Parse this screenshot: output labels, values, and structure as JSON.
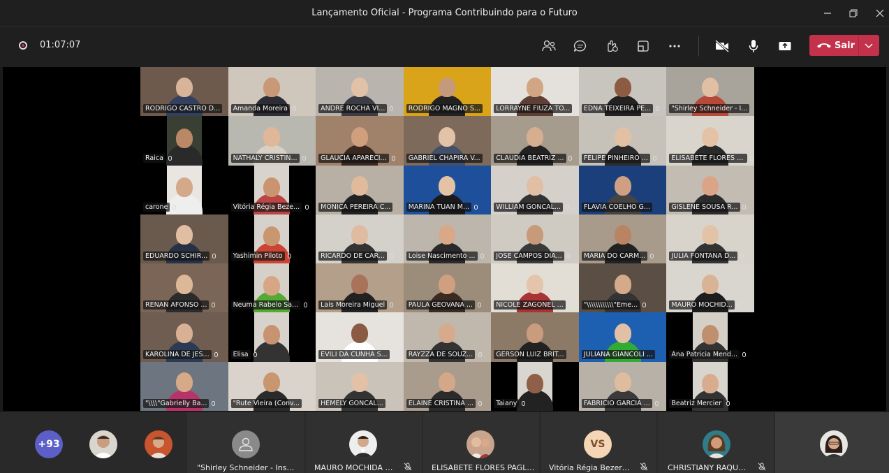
{
  "window": {
    "title": "Lançamento Oficial - Programa Contribuindo para o Futuro"
  },
  "toolbar": {
    "timer": "01:07:07",
    "leave_label": "Sair"
  },
  "colors": {
    "accent": "#5b5fc7",
    "leave": "#c4314b"
  },
  "tiles": [
    {
      "name": "RODRIGO CASTRO D...",
      "mic": false,
      "bg": "#6d5a4c",
      "skin": "#d8b49a",
      "shirt": "#33415e"
    },
    {
      "name": "Amanda Moreira",
      "mic": true,
      "bg": "#cfc6bc",
      "skin": "#c89877",
      "shirt": "#2d2d35"
    },
    {
      "name": "ANDRE ROCHA VI...",
      "mic": true,
      "bg": "#b9b4ad",
      "skin": "#e2c2a6",
      "shirt": "#3c3c44"
    },
    {
      "name": "RODRIGO MAGNO S...",
      "mic": false,
      "bg": "#d9a31a",
      "skin": "#c59a7c",
      "shirt": "#222"
    },
    {
      "name": "LORRAYNE FIUZA TO...",
      "mic": false,
      "bg": "#e4e1dc",
      "skin": "#d2a584",
      "shirt": "#5d3f35"
    },
    {
      "name": "EDNA TEIXEIRA PE...",
      "mic": true,
      "bg": "#c8c5bf",
      "skin": "#8d5b42",
      "shirt": "#222"
    },
    {
      "name": "\"Shirley Schneider - I...",
      "mic": false,
      "bg": "#a8a39b",
      "skin": "#e1bfa2",
      "shirt": "#b54a3b"
    },
    {
      "name": "Raica",
      "mic": true,
      "bg": "#3a3f33",
      "skin": "#b98866",
      "shirt": "#2a2a2a",
      "narrow": true
    },
    {
      "name": "NATHALY CRISTIN...",
      "mic": true,
      "bg": "#b9b8b0",
      "skin": "#e0b899",
      "shirt": "#d8d0c4"
    },
    {
      "name": "GLAUCIA APARECI...",
      "mic": true,
      "bg": "#a0826a",
      "skin": "#cf9f7e",
      "shirt": "#3a2820"
    },
    {
      "name": "GABRIEL CHAPIRA V...",
      "mic": false,
      "bg": "#7d6a5a",
      "skin": "#e2c3a8",
      "shirt": "#44506a"
    },
    {
      "name": "CLAUDIA BEATRIZ ...",
      "mic": true,
      "bg": "#a59c8e",
      "skin": "#d6ae90",
      "shirt": "#222"
    },
    {
      "name": "FELIPE PINHEIRO ...",
      "mic": true,
      "bg": "#c6c2ba",
      "skin": "#e2c0a4",
      "shirt": "#2b2b2b"
    },
    {
      "name": "ELISABETE FLORES P...",
      "mic": true,
      "bg": "#d9d5cc",
      "skin": "#e4c2a5",
      "shirt": "#2a2a2a"
    },
    {
      "name": "carone",
      "mic": true,
      "bg": "#e9e6e1",
      "skin": "#d3a98a",
      "shirt": "#eee",
      "narrow": true
    },
    {
      "name": "Vitória Régia Beze...",
      "mic": true,
      "bg": "#d8d4cd",
      "skin": "#c9946f",
      "shirt": "#b44",
      "narrow": true
    },
    {
      "name": "MONICA PEREIRA C...",
      "mic": false,
      "bg": "#b8b0a4",
      "skin": "#e0bb9b",
      "shirt": "#222"
    },
    {
      "name": "MARINA TUAN M...",
      "mic": true,
      "bg": "#1e4f9a",
      "skin": "#e4c2a6",
      "shirt": "#1a1a1a"
    },
    {
      "name": "WILLIAM GONCAL...",
      "mic": true,
      "bg": "#d5d1ca",
      "skin": "#e1bfa4",
      "shirt": "#333"
    },
    {
      "name": "FLAVIA COELHO G...",
      "mic": false,
      "bg": "#1b3f7a",
      "skin": "#cf9f82",
      "shirt": "#444"
    },
    {
      "name": "GISLENE SOUSA R...",
      "mic": true,
      "bg": "#c2bcb2",
      "skin": "#d9a586",
      "shirt": "#2c2c2c"
    },
    {
      "name": "EDUARDO SCHIR...",
      "mic": true,
      "bg": "#6a5a4d",
      "skin": "#e0bea2",
      "shirt": "#263145"
    },
    {
      "name": "Yashimin Piloto",
      "mic": true,
      "bg": "#d6d2cb",
      "skin": "#c8966f",
      "shirt": "#c43",
      "narrow": true
    },
    {
      "name": "RICARDO DE CAR...",
      "mic": true,
      "bg": "#d4d1cb",
      "skin": "#dfbc9f",
      "shirt": "#333"
    },
    {
      "name": "Loise Nascimento ...",
      "mic": true,
      "bg": "#bcb6ac",
      "skin": "#d9a888",
      "shirt": "#2a2a2a"
    },
    {
      "name": "JOSE CAMPOS DIA...",
      "mic": true,
      "bg": "#cfcac2",
      "skin": "#c79a7a",
      "shirt": "#3a3a3a"
    },
    {
      "name": "MARIA DO CARM...",
      "mic": true,
      "bg": "#a89b8b",
      "skin": "#b98463",
      "shirt": "#222"
    },
    {
      "name": "JULIA FONTANA D...",
      "mic": true,
      "bg": "#d8d3cb",
      "skin": "#e3c3a8",
      "shirt": "#333"
    },
    {
      "name": "RENAN AFONSO ...",
      "mic": true,
      "bg": "#7a6556",
      "skin": "#dcb899",
      "shirt": "#2b2b2b"
    },
    {
      "name": "Neuma Rabelo Sa...",
      "mic": true,
      "bg": "#d5d0c8",
      "skin": "#d6a685",
      "shirt": "#5a3",
      "narrow": true
    },
    {
      "name": "Lais Moreira Miguel",
      "mic": true,
      "bg": "#b39f8a",
      "skin": "#a9725a",
      "shirt": "#222"
    },
    {
      "name": "PAULA GEOVANA ...",
      "mic": true,
      "bg": "#9c8c7a",
      "skin": "#cf9f80",
      "shirt": "#3b2a22"
    },
    {
      "name": "NICOLE ZAGONEL ...",
      "mic": true,
      "bg": "#e2ded6",
      "skin": "#e4c4aa",
      "shirt": "#a33"
    },
    {
      "name": "\"\\\\\\\\\\\\\\\\\\\\\\\\\"Eme...",
      "mic": true,
      "bg": "#5b4f45",
      "skin": "#d5aa8a",
      "shirt": "#333"
    },
    {
      "name": "MAURO MOCHID...",
      "mic": true,
      "bg": "#d9d6d0",
      "skin": "#d9b396",
      "shirt": "#1d1d1d"
    },
    {
      "name": "KAROLINA DE JES...",
      "mic": true,
      "bg": "#6e5d50",
      "skin": "#d8b093",
      "shirt": "#2b3a55"
    },
    {
      "name": "Elisa",
      "mic": true,
      "bg": "#d7d2cb",
      "skin": "#c79371",
      "shirt": "#333",
      "narrow": true
    },
    {
      "name": "EVILI DA CUNHA S...",
      "mic": false,
      "bg": "#e6e3de",
      "skin": "#8a5a42",
      "shirt": "#fff"
    },
    {
      "name": "RAYZZA DE SOUZ...",
      "mic": true,
      "bg": "#c0b8ad",
      "skin": "#d6aa8c",
      "shirt": "#333"
    },
    {
      "name": "GERSON LUIZ BRIT...",
      "mic": false,
      "bg": "#8c7a66",
      "skin": "#c99c7d",
      "shirt": "#222"
    },
    {
      "name": "JULIANA GIANCOLI ...",
      "mic": false,
      "bg": "#1d5fb0",
      "skin": "#e2c0a5",
      "shirt": "#3a3"
    },
    {
      "name": "Ana Patricia Mend...",
      "mic": true,
      "bg": "#d4cfc7",
      "skin": "#c08f6e",
      "shirt": "#333",
      "narrow": true
    },
    {
      "name": "\"\\\\\\\\\"Gabrielly Ba...",
      "mic": true,
      "bg": "#6d7580",
      "skin": "#d6a988",
      "shirt": "#b8336a"
    },
    {
      "name": "\"Rute Vieira (Conv...",
      "mic": false,
      "bg": "#d9d3cb",
      "skin": "#c8966f",
      "shirt": "#2a2a2a"
    },
    {
      "name": "HEMELY GONCAL...",
      "mic": false,
      "bg": "#c9c3ba",
      "skin": "#e3c1a6",
      "shirt": "#333"
    },
    {
      "name": "ELAINE CRISTINA ...",
      "mic": true,
      "bg": "#a99c8d",
      "skin": "#d4a789",
      "shirt": "#2b2b2b"
    },
    {
      "name": "Taiany",
      "mic": true,
      "bg": "#d9d5cf",
      "skin": "#8f6048",
      "shirt": "#222",
      "narrow": true
    },
    {
      "name": "FABRICIO GARCIA ...",
      "mic": true,
      "bg": "#b7b1a8",
      "skin": "#dfbc9e",
      "shirt": "#3a3a3a"
    },
    {
      "name": "Beatriz Mercier",
      "mic": true,
      "bg": "#d8d4ce",
      "skin": "#d8ad8f",
      "shirt": "#333",
      "narrow": true
    }
  ],
  "bottom": {
    "overflow_count": "+93",
    "participants": [
      {
        "name": "\"Shirley Schneider - Institu...",
        "muted": false
      },
      {
        "name": "MAURO MOCHIDA PE...",
        "muted": true
      },
      {
        "name": "ELISABETE FLORES PAGLIUSI",
        "muted": false
      },
      {
        "name": "Vitória Régia Bezerra ...",
        "muted": true,
        "initials": "VS"
      },
      {
        "name": "CHRISTIANY RAQUEL ...",
        "muted": true
      }
    ]
  }
}
